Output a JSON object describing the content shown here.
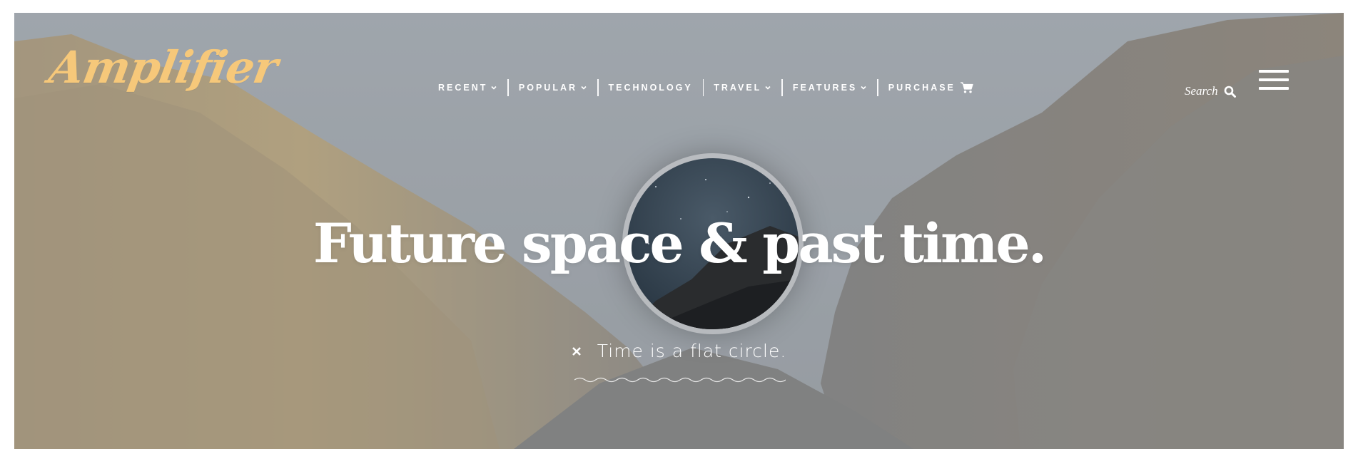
{
  "header": {
    "logo_text": "Amplifier",
    "logo_color": "#f6c87a",
    "nav": [
      {
        "label": "RECENT",
        "has_dropdown": true
      },
      {
        "label": "POPULAR",
        "has_dropdown": true
      },
      {
        "label": "TECHNOLOGY",
        "has_dropdown": false
      },
      {
        "label": "TRAVEL",
        "has_dropdown": true
      },
      {
        "label": "FEATURES",
        "has_dropdown": true
      },
      {
        "label": "PURCHASE",
        "has_dropdown": false,
        "icon": "cart-icon"
      }
    ],
    "search_label": "Search",
    "search_icon": "search-icon",
    "menu_icon": "hamburger-icon"
  },
  "hero": {
    "headline": "Future space & past time.",
    "tag_icon": "close-icon",
    "tag_text": "Time is a flat circle."
  }
}
